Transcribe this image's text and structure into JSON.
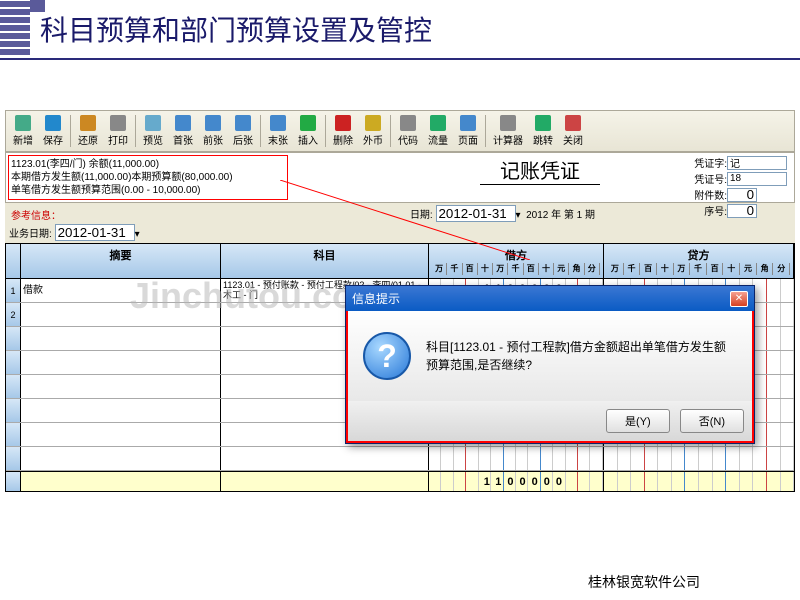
{
  "slide": {
    "title": "科目预算和部门预算设置及管控"
  },
  "toolbar": [
    {
      "label": "新增",
      "icon": "#4a8"
    },
    {
      "label": "保存",
      "icon": "#28c"
    },
    {
      "label": "还原",
      "icon": "#c82"
    },
    {
      "label": "打印",
      "icon": "#888"
    },
    {
      "label": "预览",
      "icon": "#6ac"
    },
    {
      "label": "首张",
      "icon": "#48c"
    },
    {
      "label": "前张",
      "icon": "#48c"
    },
    {
      "label": "后张",
      "icon": "#48c"
    },
    {
      "label": "末张",
      "icon": "#48c"
    },
    {
      "label": "插入",
      "icon": "#2a4"
    },
    {
      "label": "删除",
      "icon": "#c22"
    },
    {
      "label": "外币",
      "icon": "#ca2"
    },
    {
      "label": "代码",
      "icon": "#888"
    },
    {
      "label": "流量",
      "icon": "#2a6"
    },
    {
      "label": "页面",
      "icon": "#48c"
    },
    {
      "label": "计算器",
      "icon": "#888"
    },
    {
      "label": "跳转",
      "icon": "#2a6"
    },
    {
      "label": "关闭",
      "icon": "#c44"
    }
  ],
  "info": {
    "line1": "1123.01(李四/门) 余额(11,000.00)",
    "line2": "本期借方发生额(11,000.00)本期预算额(80,000.00)",
    "line3": "单笔借方发生额预算范围(0.00 - 10,000.00)"
  },
  "doc_title": "记账凭证",
  "meta": {
    "vtype_label": "凭证字:",
    "vtype": "记",
    "vno_label": "凭证号:",
    "vno": "18",
    "attach_label": "附件数:",
    "attach": "0",
    "seq_label": "序号:",
    "seq": "0"
  },
  "ref": {
    "label": "参考信息：",
    "value": ""
  },
  "dates": {
    "biz_label": "业务日期:",
    "biz": "2012-01-31",
    "date_label": "日期:",
    "date": "2012-01-31",
    "period": "2012 年 第 1 期"
  },
  "grid": {
    "h_sum": "摘要",
    "h_acct": "科目",
    "h_dr": "借方",
    "h_cr": "贷方",
    "sub": "万千百十万千百十元角分",
    "rows": [
      {
        "n": "1",
        "sum": "借款",
        "acct": "1123.01 - 预付账款 - 预付工程款/02 - 李四/01.01 - 木工 - 门",
        "dr": "1100000"
      },
      {
        "n": "2",
        "sum": "",
        "acct": "",
        "dr": ""
      },
      {
        "n": "",
        "sum": "",
        "acct": "",
        "dr": ""
      },
      {
        "n": "",
        "sum": "",
        "acct": "",
        "dr": ""
      },
      {
        "n": "",
        "sum": "",
        "acct": "",
        "dr": ""
      },
      {
        "n": "",
        "sum": "",
        "acct": "",
        "dr": ""
      },
      {
        "n": "",
        "sum": "",
        "acct": "",
        "dr": ""
      },
      {
        "n": "",
        "sum": "",
        "acct": "",
        "dr": ""
      }
    ],
    "total_dr": "1100000"
  },
  "dialog": {
    "title": "信息提示",
    "message": "科目[1123.01 - 预付工程款]借方金额超出单笔借方发生额预算范围,是否继续?",
    "yes": "是(Y)",
    "no": "否(N)"
  },
  "watermark": "Jinchutou.com",
  "footer": "桂林银宽软件公司"
}
